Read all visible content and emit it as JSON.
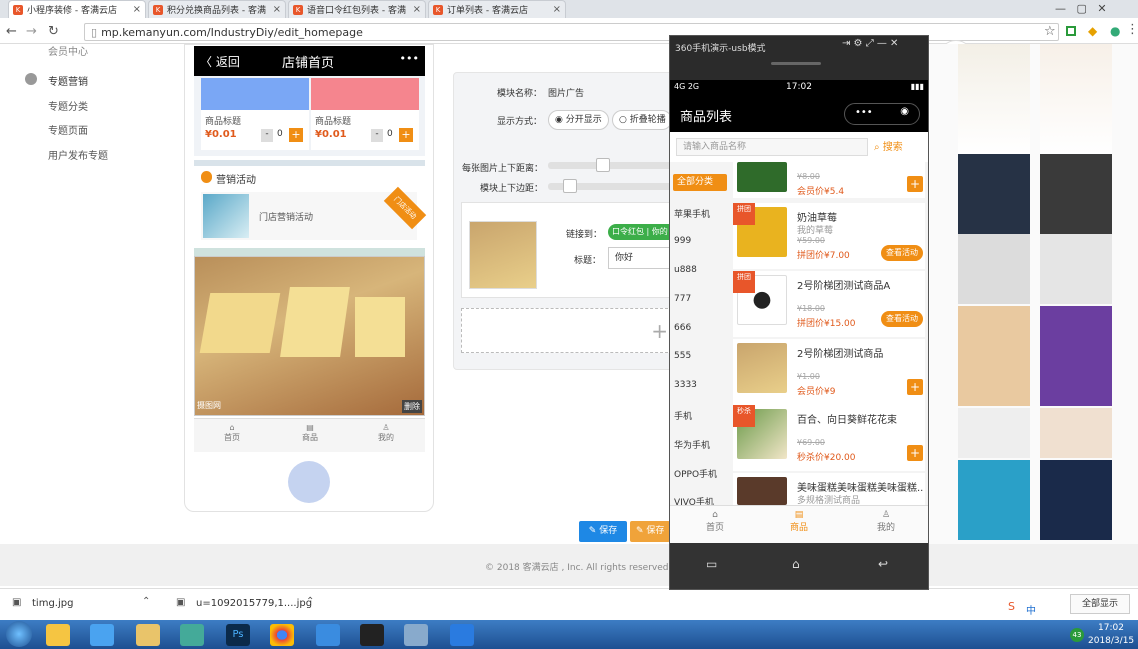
{
  "tabs": [
    {
      "label": "小程序装修 - 客满云店",
      "active": true
    },
    {
      "label": "积分兑换商品列表 - 客满",
      "active": false
    },
    {
      "label": "语音口令红包列表 - 客满",
      "active": false
    },
    {
      "label": "订单列表 - 客满云店",
      "active": false
    }
  ],
  "address": {
    "url": "mp.kemanyun.com/IndustryDiy/edit_homepage"
  },
  "left_nav": {
    "partial": "会员中心",
    "group": "专题营销",
    "items": [
      "专题分类",
      "专题页面",
      "用户发布专题"
    ]
  },
  "preview": {
    "back_label": "返回",
    "title": "店铺首页",
    "more": "•••",
    "goods": [
      {
        "name": "商品标题",
        "price": "¥0.01",
        "qty": "0",
        "color": "#7aa7f5"
      },
      {
        "name": "商品标题",
        "price": "¥0.01",
        "qty": "0",
        "color": "#f5858e"
      }
    ],
    "promo_title": "营销活动",
    "promo_item": "门店营销活动",
    "promo_ribbon": "门店活动",
    "image_watermark": "摄图网",
    "delete_label": "删除",
    "tabbar": [
      "首页",
      "商品",
      "我的"
    ]
  },
  "editor": {
    "module_name_label": "模块名称：",
    "module_name_value": "图片广告",
    "display_label": "显示方式：",
    "display_opt1": "分开显示",
    "display_opt2": "折叠轮播",
    "spacing_label": "每张图片上下距离：",
    "margin_label": "模块上下边距：",
    "link_label": "链接到：",
    "link_value": "口令红包 | 你的",
    "title_label": "标题：",
    "title_value": "你好",
    "save_label": "保存",
    "save_label2": "保存"
  },
  "footer": "© 2018 客满云店 , Inc. All rights reserved.",
  "downloads": [
    {
      "name": "timg.jpg"
    },
    {
      "name": "u=1092015779,1....jpg"
    }
  ],
  "m360": {
    "title": "360手机演示-usb模式",
    "status_left": "4G 2G",
    "time": "17:02",
    "page_title": "商品列表",
    "search_placeholder": "请输入商品名称",
    "search_btn": "搜索",
    "categories": [
      "全部分类",
      "苹果手机",
      "999",
      "u888",
      "777",
      "666",
      "555",
      "3333",
      "手机",
      "华为手机",
      "OPPO手机",
      "VIVO手机"
    ],
    "goods": [
      {
        "name": "",
        "sub": "",
        "old": "¥8.00",
        "price": "会员价¥5.4",
        "btn": "+"
      },
      {
        "name": "奶油草莓",
        "sub": "我的草莓",
        "old": "¥59.00",
        "price": "拼团价¥7.00",
        "btn": "查看活动",
        "ribbon": "拼团"
      },
      {
        "name": "2号阶梯团测试商品A",
        "sub": "",
        "old": "¥18.00",
        "price": "拼团价¥15.00",
        "btn": "查看活动",
        "ribbon": "拼团"
      },
      {
        "name": "2号阶梯团测试商品",
        "sub": "",
        "old": "¥1.00",
        "price": "会员价¥9",
        "btn": "+"
      },
      {
        "name": "百合、向日葵鲜花花束",
        "sub": "",
        "old": "¥69.00",
        "price": "秒杀价¥20.00",
        "btn": "+",
        "ribbon": "秒杀"
      },
      {
        "name": "美味蛋糕美味蛋糕美味蛋糕...",
        "sub": "多规格测试商品",
        "old": "",
        "price": "",
        "btn": ""
      }
    ],
    "tabbar": [
      "首页",
      "商品",
      "我的"
    ]
  },
  "tray": {
    "ime": "中",
    "time": "17:02",
    "date": "2018/3/15",
    "badge": "43",
    "show_all": "全部显示"
  },
  "colors": {
    "accent": "#f08e14",
    "blue": "#1e88e5",
    "price": "#e05a1c"
  }
}
